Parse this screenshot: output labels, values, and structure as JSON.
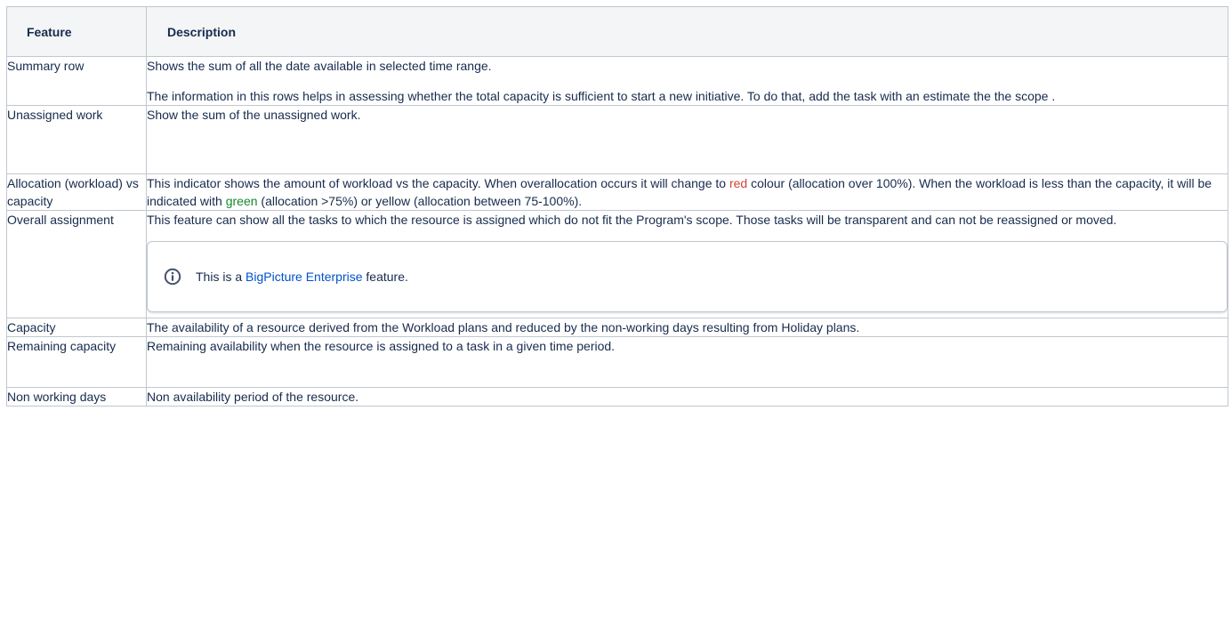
{
  "table": {
    "headers": [
      "Feature",
      "Description"
    ],
    "rows": [
      {
        "feature": "Summary row",
        "paragraphs": [
          "Shows the sum of all the date available in selected time range.",
          "The information in this rows helps in assessing whether the total capacity is sufficient to start a new initiative. To do that, add the task with an estimate the the scope ."
        ]
      },
      {
        "feature": "Unassigned work",
        "description": "Show the sum of the unassigned work."
      },
      {
        "feature": "Allocation (workload) vs capacity",
        "desc_part1": "This indicator shows the amount of workload vs the capacity. When overallocation occurs it will change to ",
        "red_word": "red",
        "desc_part2": " colour (allocation over 100%). When the workload is less than the capacity, it will be indicated with ",
        "green_word": "green",
        "desc_part3": " (allocation >75%) or yellow (allocation between 75-100%)."
      },
      {
        "feature": "Overall assignment",
        "description": "This feature can show all the tasks to which the resource is assigned which do not fit the Program's scope. Those tasks will be transparent and can not be reassigned or moved.",
        "info_panel": {
          "icon": "info-circle-icon",
          "prefix": "This is a ",
          "link_text": "BigPicture Enterprise",
          "suffix": " feature."
        }
      },
      {
        "feature": "Capacity",
        "description": "The availability of a resource derived from the Workload plans and reduced by the non-working days resulting from Holiday plans."
      },
      {
        "feature": "Remaining capacity",
        "description": "Remaining availability when the resource is assigned to a task in a given time period."
      },
      {
        "feature": "Non working days",
        "description": "Non availability period of the resource."
      }
    ]
  },
  "colors": {
    "text": "#172b4d",
    "header_background": "#f4f5f7",
    "border": "#c1c7d0",
    "red": "#d04437",
    "green": "#14892c",
    "link": "#0052cc",
    "info_icon": "#42526e"
  }
}
